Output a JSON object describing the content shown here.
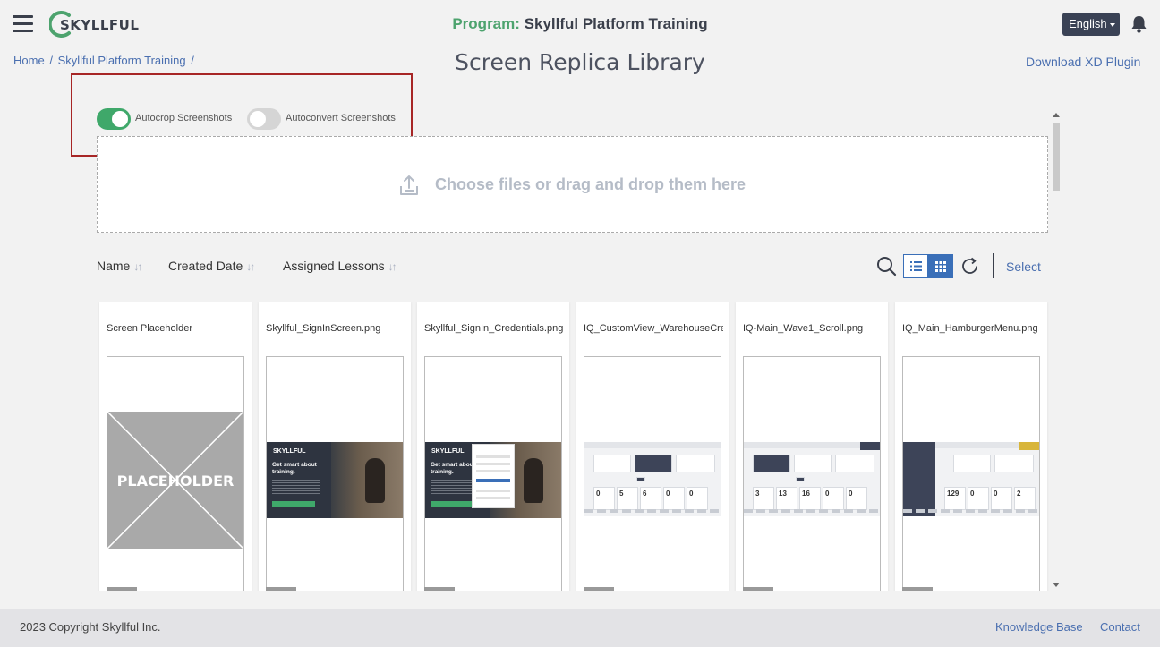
{
  "header": {
    "logo_text": "SKYLLFUL",
    "program_label": "Program:",
    "program_name": "Skyllful Platform Training",
    "language": "English"
  },
  "breadcrumb": {
    "home": "Home",
    "program": "Skyllful Platform Training",
    "separator": "/"
  },
  "page_title": "Screen Replica Library",
  "download_link": "Download XD Plugin",
  "toggles": {
    "autocrop": {
      "label": "Autocrop Screenshots",
      "on": true
    },
    "autoconvert": {
      "label": "Autoconvert Screenshots",
      "on": false
    }
  },
  "dropzone": {
    "text": "Choose files or drag and drop them here"
  },
  "sort": {
    "name": "Name",
    "created": "Created Date",
    "assigned": "Assigned Lessons"
  },
  "toolbar": {
    "select": "Select"
  },
  "cards": [
    {
      "name": "Screen Placeholder",
      "placeholder_text": "PLACEHOLDER"
    },
    {
      "name": "Skyllful_SignInScreen.png",
      "hero_logo": "SKYLLFUL",
      "hero_headline": "Get smart about training."
    },
    {
      "name": "Skyllful_SignIn_Credentials.png",
      "hero_logo": "SKYLLFUL",
      "hero_headline": "Get smart about training."
    },
    {
      "name": "IQ_CustomView_WarehouseCrew.png",
      "n1": "0",
      "n2": "5",
      "n3": "6",
      "n4": "0",
      "n5": "0"
    },
    {
      "name": "IQ-Main_Wave1_Scroll.png",
      "n1": "3",
      "n2": "13",
      "n3": "16",
      "n4": "0",
      "n5": "0"
    },
    {
      "name": "IQ_Main_HamburgerMenu.png",
      "n1": "129",
      "n2": "0",
      "n3": "0",
      "n4": "2"
    }
  ],
  "footer": {
    "copyright": "2023 Copyright Skyllful Inc.",
    "knowledge_base": "Knowledge Base",
    "contact": "Contact"
  },
  "colors": {
    "brand_green": "#4da36e",
    "link_blue": "#4a6fb0",
    "navy": "#3a4255",
    "highlight_red": "#a72626"
  }
}
